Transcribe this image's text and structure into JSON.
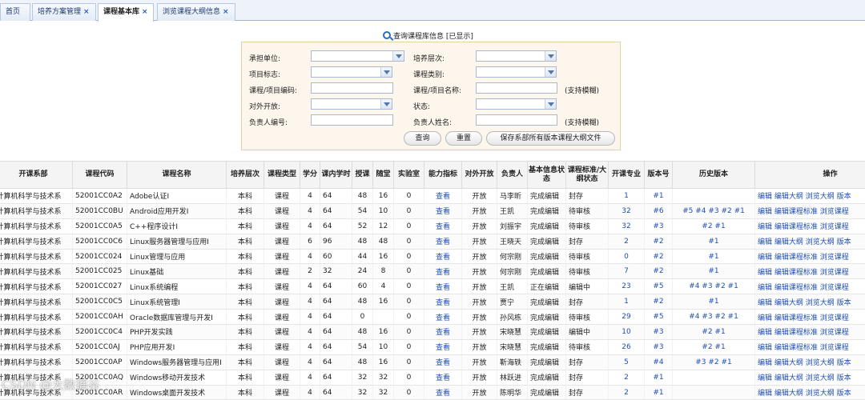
{
  "tabs": [
    {
      "label": "首页",
      "closable": false
    },
    {
      "label": "培养方案管理",
      "closable": true
    },
    {
      "label": "课程基本库",
      "closable": true,
      "active": true
    },
    {
      "label": "浏览课程大纲信息",
      "closable": true
    }
  ],
  "tab_close_glyph": "×",
  "query": {
    "title": "查询课程库信息 [已显示]",
    "unit_label": "承担单位:",
    "level_label": "培养层次:",
    "flag_label": "项目标志:",
    "category_label": "课程类别:",
    "code_label": "课程/项目编码:",
    "name_label": "课程/项目名称:",
    "name_hint": "(支持模糊)",
    "open_label": "对外开放:",
    "status_label": "状态:",
    "owner_id_label": "负责人编号:",
    "owner_name_label": "负责人姓名:",
    "owner_hint": "(支持模糊)",
    "search_button": "查询",
    "reset_button": "重置",
    "save_all_button": "保存系部所有版本课程大纲文件"
  },
  "table": {
    "headers": [
      "开课系部",
      "课程代码",
      "课程名称",
      "培养层次",
      "课程类型",
      "学分",
      "课内学时",
      "授课",
      "随堂",
      "实验室",
      "能力指标",
      "对外开放",
      "负责人",
      "基本信息状态",
      "课程标准/大纲状态",
      "开课专业",
      "版本号",
      "历史版本",
      "操作"
    ],
    "rows": [
      [
        "计算机科学与技术系",
        "52001CC0A2",
        "Adobe认证I",
        "本科",
        "课程",
        "4",
        "64",
        "48",
        "16",
        "0",
        "查看",
        "开放",
        "马李昕",
        "完成编辑",
        "封存",
        "1",
        "#1",
        "",
        "编辑 编辑大纲 浏览大纲 版本"
      ],
      [
        "计算机科学与技术系",
        "52001CC0BU",
        "Android应用开发I",
        "本科",
        "课程",
        "4",
        "64",
        "54",
        "10",
        "0",
        "查看",
        "开放",
        "王凯",
        "完成编辑",
        "待审核",
        "32",
        "#6",
        "#5 #4 #3 #2 #1",
        "编辑 编辑课程标准 浏览课程"
      ],
      [
        "计算机科学与技术系",
        "52001CC0A5",
        "C++程序设计I",
        "本科",
        "课程",
        "4",
        "64",
        "52",
        "12",
        "0",
        "查看",
        "开放",
        "刘振宇",
        "完成编辑",
        "待审核",
        "32",
        "#3",
        "#2 #1",
        "编辑 编辑课程标准 浏览课程"
      ],
      [
        "计算机科学与技术系",
        "52001CC0C6",
        "Linux服务器管理与应用I",
        "本科",
        "课程",
        "6",
        "96",
        "48",
        "48",
        "0",
        "查看",
        "开放",
        "王晓天",
        "完成编辑",
        "封存",
        "2",
        "#2",
        "#1",
        "编辑 编辑大纲 浏览大纲 版本"
      ],
      [
        "计算机科学与技术系",
        "52001CC024",
        "Linux管理与应用",
        "本科",
        "课程",
        "4",
        "60",
        "44",
        "16",
        "0",
        "查看",
        "开放",
        "何宗刚",
        "完成编辑",
        "待审核",
        "0",
        "#2",
        "#1",
        "编辑 编辑课程标准 浏览课程"
      ],
      [
        "计算机科学与技术系",
        "52001CC025",
        "Linux基础",
        "本科",
        "课程",
        "2",
        "32",
        "24",
        "8",
        "0",
        "查看",
        "开放",
        "何宗刚",
        "完成编辑",
        "待审核",
        "7",
        "#2",
        "#1",
        "编辑 编辑课程标准 浏览课程"
      ],
      [
        "计算机科学与技术系",
        "52001CC027",
        "Linux系统编程",
        "本科",
        "课程",
        "4",
        "64",
        "60",
        "4",
        "0",
        "查看",
        "开放",
        "王凯",
        "正在编辑",
        "编辑中",
        "23",
        "#5",
        "#4 #3 #2 #1",
        "编辑 编辑课程标准 浏览课程"
      ],
      [
        "计算机科学与技术系",
        "52001CC0C5",
        "Linux系统管理I",
        "本科",
        "课程",
        "4",
        "64",
        "48",
        "16",
        "0",
        "查看",
        "开放",
        "贾宁",
        "完成编辑",
        "封存",
        "1",
        "#2",
        "#1",
        "编辑 编辑大纲 浏览大纲 版本"
      ],
      [
        "计算机科学与技术系",
        "52001CC0AH",
        "Oracle数据库管理与开发I",
        "本科",
        "课程",
        "4",
        "64",
        "0",
        "",
        "0",
        "查看",
        "开放",
        "孙风栋",
        "完成编辑",
        "待审核",
        "29",
        "#5",
        "#4 #3 #2 #1",
        "编辑 编辑课程标准 浏览课程"
      ],
      [
        "计算机科学与技术系",
        "52001CC0C4",
        "PHP开发实践",
        "本科",
        "课程",
        "4",
        "64",
        "48",
        "16",
        "0",
        "查看",
        "开放",
        "宋晓慧",
        "完成编辑",
        "编辑中",
        "10",
        "#3",
        "#2 #1",
        "编辑 编辑课程标准 浏览课程"
      ],
      [
        "计算机科学与技术系",
        "52001CC0AJ",
        "PHP应用开发I",
        "本科",
        "课程",
        "4",
        "64",
        "54",
        "10",
        "0",
        "查看",
        "开放",
        "宋晓慧",
        "完成编辑",
        "待审核",
        "26",
        "#3",
        "#2 #1",
        "编辑 编辑课程标准 浏览课程"
      ],
      [
        "计算机科学与技术系",
        "52001CC0AP",
        "Windows服务器管理与应用I",
        "本科",
        "课程",
        "4",
        "64",
        "48",
        "16",
        "0",
        "查看",
        "开放",
        "靳海轶",
        "完成编辑",
        "封存",
        "5",
        "#4",
        "#3 #2 #1",
        "编辑 编辑大纲 浏览大纲 版本"
      ],
      [
        "计算机科学与技术系",
        "52001CC0AQ",
        "Windows移动开发技术",
        "本科",
        "课程",
        "4",
        "64",
        "32",
        "32",
        "0",
        "查看",
        "开放",
        "林跃进",
        "完成编辑",
        "封存",
        "2",
        "#1",
        "",
        "编辑 编辑大纲 浏览大纲 版本"
      ],
      [
        "计算机科学与技术系",
        "52001CC0AR",
        "Windows桌面开发技术",
        "本科",
        "课程",
        "4",
        "64",
        "32",
        "32",
        "0",
        "查看",
        "开放",
        "陈明华",
        "完成编辑",
        "封存",
        "2",
        "#1",
        "",
        "编辑 编辑大纲 浏览大纲 版本"
      ]
    ]
  },
  "watermark": "CSDN @大数据谷"
}
